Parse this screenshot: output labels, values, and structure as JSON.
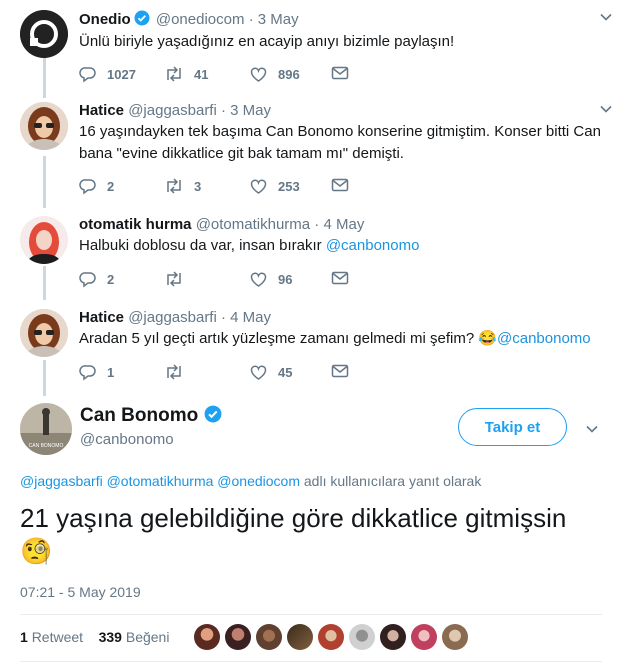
{
  "tweets": [
    {
      "name": "Onedio",
      "verified": true,
      "handle": "@onediocom",
      "dot": "·",
      "time": "3 May",
      "text": "Ünlü biriyle yaşadığınız en acayip anıyı bizimle paylaşın!",
      "replies": "1027",
      "retweets": "41",
      "likes": "896"
    },
    {
      "name": "Hatice",
      "verified": false,
      "handle": "@jaggasbarfi",
      "dot": "·",
      "time": "3 May",
      "text": "16 yaşındayken tek başıma Can Bonomo konserine gitmiştim. Konser bitti Can bana \"evine dikkatlice git bak tamam mı\" demişti.",
      "replies": "2",
      "retweets": "3",
      "likes": "253"
    },
    {
      "name": "otomatik hurma",
      "verified": false,
      "handle": "@otomatikhurma",
      "dot": "·",
      "time": "4 May",
      "text": "Halbuki doblosu da var, insan bırakır ",
      "mention": "@canbonomo",
      "replies": "2",
      "retweets": "",
      "likes": "96"
    },
    {
      "name": "Hatice",
      "verified": false,
      "handle": "@jaggasbarfi",
      "dot": "·",
      "time": "4 May",
      "text": "Aradan 5 yıl geçti artık yüzleşme zamanı gelmedi mi şefim? ",
      "emoji": "😂",
      "mention": "@canbonomo",
      "replies": "1",
      "retweets": "",
      "likes": "45"
    }
  ],
  "main_tweet": {
    "name": "Can Bonomo",
    "verified": true,
    "handle": "@canbonomo",
    "follow_label": "Takip et",
    "reply_to_mentions": "@jaggasbarfi @otomatikhurma @onediocom",
    "reply_to_suffix": " adlı kullanıcılara yanıt olarak",
    "text": "21 yaşına gelebildiğine göre dikkatlice gitmişsin",
    "emoji": "🧐",
    "timestamp": "07:21 - 5 May 2019",
    "retweet_count": "1",
    "retweet_label": "Retweet",
    "like_count": "339",
    "like_label": "Beğeni",
    "avatar_caption": "CAN BONOMO"
  },
  "colors": {
    "accent": "#1da1f2",
    "mention": "#1b95e0",
    "muted": "#657786",
    "thread_line": "#ccd6dd"
  }
}
